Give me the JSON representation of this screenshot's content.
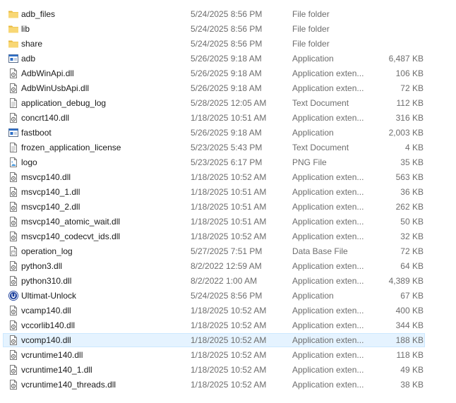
{
  "files": [
    {
      "name": "adb_files",
      "date": "5/24/2025 8:56 PM",
      "type": "File folder",
      "size": "",
      "icon": "folder-icon"
    },
    {
      "name": "lib",
      "date": "5/24/2025 8:56 PM",
      "type": "File folder",
      "size": "",
      "icon": "folder-icon"
    },
    {
      "name": "share",
      "date": "5/24/2025 8:56 PM",
      "type": "File folder",
      "size": "",
      "icon": "folder-icon"
    },
    {
      "name": "adb",
      "date": "5/26/2025 9:18 AM",
      "type": "Application",
      "size": "6,487 KB",
      "icon": "application-icon"
    },
    {
      "name": "AdbWinApi.dll",
      "date": "5/26/2025 9:18 AM",
      "type": "Application exten...",
      "size": "106 KB",
      "icon": "dll-file-icon"
    },
    {
      "name": "AdbWinUsbApi.dll",
      "date": "5/26/2025 9:18 AM",
      "type": "Application exten...",
      "size": "72 KB",
      "icon": "dll-file-icon"
    },
    {
      "name": "application_debug_log",
      "date": "5/28/2025 12:05 AM",
      "type": "Text Document",
      "size": "112 KB",
      "icon": "text-file-icon"
    },
    {
      "name": "concrt140.dll",
      "date": "1/18/2025 10:51 AM",
      "type": "Application exten...",
      "size": "316 KB",
      "icon": "dll-file-icon"
    },
    {
      "name": "fastboot",
      "date": "5/26/2025 9:18 AM",
      "type": "Application",
      "size": "2,003 KB",
      "icon": "application-icon"
    },
    {
      "name": "frozen_application_license",
      "date": "5/23/2025 5:43 PM",
      "type": "Text Document",
      "size": "4 KB",
      "icon": "text-file-icon"
    },
    {
      "name": "logo",
      "date": "5/23/2025 6:17 PM",
      "type": "PNG File",
      "size": "35 KB",
      "icon": "image-file-icon"
    },
    {
      "name": "msvcp140.dll",
      "date": "1/18/2025 10:52 AM",
      "type": "Application exten...",
      "size": "563 KB",
      "icon": "dll-file-icon"
    },
    {
      "name": "msvcp140_1.dll",
      "date": "1/18/2025 10:51 AM",
      "type": "Application exten...",
      "size": "36 KB",
      "icon": "dll-file-icon"
    },
    {
      "name": "msvcp140_2.dll",
      "date": "1/18/2025 10:51 AM",
      "type": "Application exten...",
      "size": "262 KB",
      "icon": "dll-file-icon"
    },
    {
      "name": "msvcp140_atomic_wait.dll",
      "date": "1/18/2025 10:51 AM",
      "type": "Application exten...",
      "size": "50 KB",
      "icon": "dll-file-icon"
    },
    {
      "name": "msvcp140_codecvt_ids.dll",
      "date": "1/18/2025 10:52 AM",
      "type": "Application exten...",
      "size": "32 KB",
      "icon": "dll-file-icon"
    },
    {
      "name": "operation_log",
      "date": "5/27/2025 7:51 PM",
      "type": "Data Base File",
      "size": "72 KB",
      "icon": "database-file-icon"
    },
    {
      "name": "python3.dll",
      "date": "8/2/2022 12:59 AM",
      "type": "Application exten...",
      "size": "64 KB",
      "icon": "dll-file-icon"
    },
    {
      "name": "python310.dll",
      "date": "8/2/2022 1:00 AM",
      "type": "Application exten...",
      "size": "4,389 KB",
      "icon": "dll-file-icon"
    },
    {
      "name": "Ultimat-Unlock",
      "date": "5/24/2025 8:56 PM",
      "type": "Application",
      "size": "67 KB",
      "icon": "unlock-app-icon"
    },
    {
      "name": "vcamp140.dll",
      "date": "1/18/2025 10:52 AM",
      "type": "Application exten...",
      "size": "400 KB",
      "icon": "dll-file-icon"
    },
    {
      "name": "vccorlib140.dll",
      "date": "1/18/2025 10:52 AM",
      "type": "Application exten...",
      "size": "344 KB",
      "icon": "dll-file-icon"
    },
    {
      "name": "vcomp140.dll",
      "date": "1/18/2025 10:52 AM",
      "type": "Application exten...",
      "size": "188 KB",
      "icon": "dll-file-icon",
      "selected": true
    },
    {
      "name": "vcruntime140.dll",
      "date": "1/18/2025 10:52 AM",
      "type": "Application exten...",
      "size": "118 KB",
      "icon": "dll-file-icon"
    },
    {
      "name": "vcruntime140_1.dll",
      "date": "1/18/2025 10:52 AM",
      "type": "Application exten...",
      "size": "49 KB",
      "icon": "dll-file-icon"
    },
    {
      "name": "vcruntime140_threads.dll",
      "date": "1/18/2025 10:52 AM",
      "type": "Application exten...",
      "size": "38 KB",
      "icon": "dll-file-icon"
    }
  ],
  "colors": {
    "selection_bg": "#e5f3ff",
    "selection_border": "#cce8ff",
    "folder": "#f8d775",
    "secondary_text": "#6d6d6d"
  }
}
